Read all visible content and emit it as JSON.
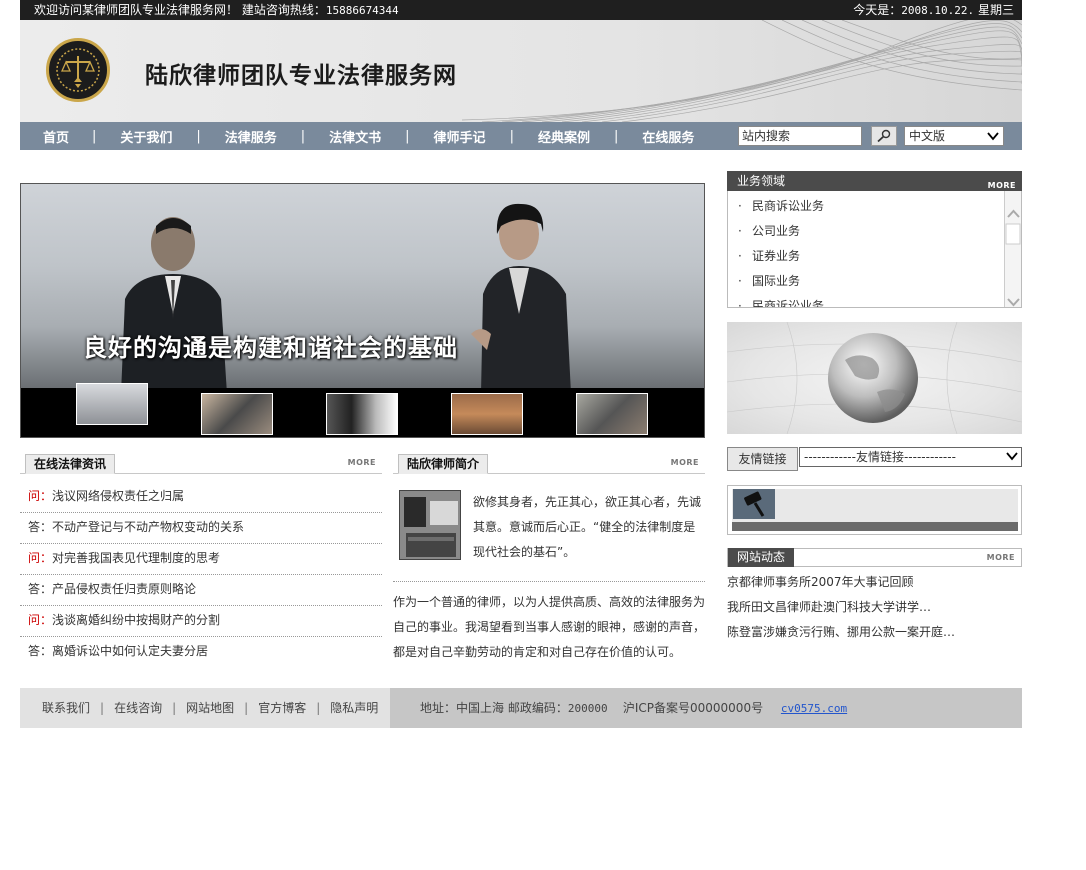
{
  "topbar": {
    "welcome": "欢迎访问某律师团队专业法律服务网！ 建站咨询热线：",
    "hotline": "15886674344",
    "date_label": "今天是：",
    "date": "2008.10.22.",
    "weekday": "星期三"
  },
  "header": {
    "site_title": "陆欣律师团队专业法律服务网"
  },
  "nav": {
    "items": [
      "首页",
      "关于我们",
      "法律服务",
      "法律文书",
      "律师手记",
      "经典案例",
      "在线服务"
    ],
    "search_value": "站内搜索",
    "language": "中文版",
    "icons": {
      "search": "search-icon"
    }
  },
  "banner": {
    "slogan": "良好的沟通是构建和谐社会的基础"
  },
  "news": {
    "title": "在线法律资讯",
    "more": "MORE",
    "items": [
      {
        "prefix": "问：",
        "text": "浅议网络侵权责任之归属",
        "type": "q"
      },
      {
        "prefix": "答：",
        "text": "不动产登记与不动产物权变动的关系",
        "type": "a"
      },
      {
        "prefix": "问：",
        "text": "对完善我国表见代理制度的思考",
        "type": "q"
      },
      {
        "prefix": "答：",
        "text": "产品侵权责任归责原则略论",
        "type": "a"
      },
      {
        "prefix": "问：",
        "text": "浅谈离婚纠纷中按揭财产的分割",
        "type": "q"
      },
      {
        "prefix": "答：",
        "text": "离婚诉讼中如何认定夫妻分居",
        "type": "a"
      }
    ]
  },
  "intro": {
    "title": "陆欣律师简介",
    "more": "MORE",
    "short_text": "欲修其身者，先正其心，欲正其心者，先诚其意。意诚而后心正。“健全的法律制度是 现代社会的基石”。",
    "long_text": "作为一个普通的律师，以为人提供高质、高效的法律服务为自己的事业。我渴望看到当事人感谢的眼神，感谢的声音，都是对自己辛勤劳动的肯定和对自己存在价值的认可。"
  },
  "areas": {
    "title": "业务领域",
    "more": "MORE",
    "items": [
      "民商诉讼业务",
      "公司业务",
      "证券业务",
      "国际业务",
      "民商诉讼业务"
    ]
  },
  "links": {
    "button": "友情链接",
    "select": "------------友情链接------------"
  },
  "dynamics": {
    "title": "网站动态",
    "more": "MORE",
    "items": [
      "京都律师事务所2007年大事记回顾",
      "我所田文昌律师赴澳门科技大学讲学…",
      "陈登富涉嫌贪污行贿、挪用公款一案开庭…"
    ]
  },
  "footer": {
    "links": [
      "联系我们",
      "在线咨询",
      "网站地图",
      "官方博客",
      "隐私声明"
    ],
    "address_label": "地址：中国上海 邮政编码：",
    "postcode": "200000",
    "icp": "沪ICP备案号00000000号",
    "site": "cv0575.com"
  }
}
